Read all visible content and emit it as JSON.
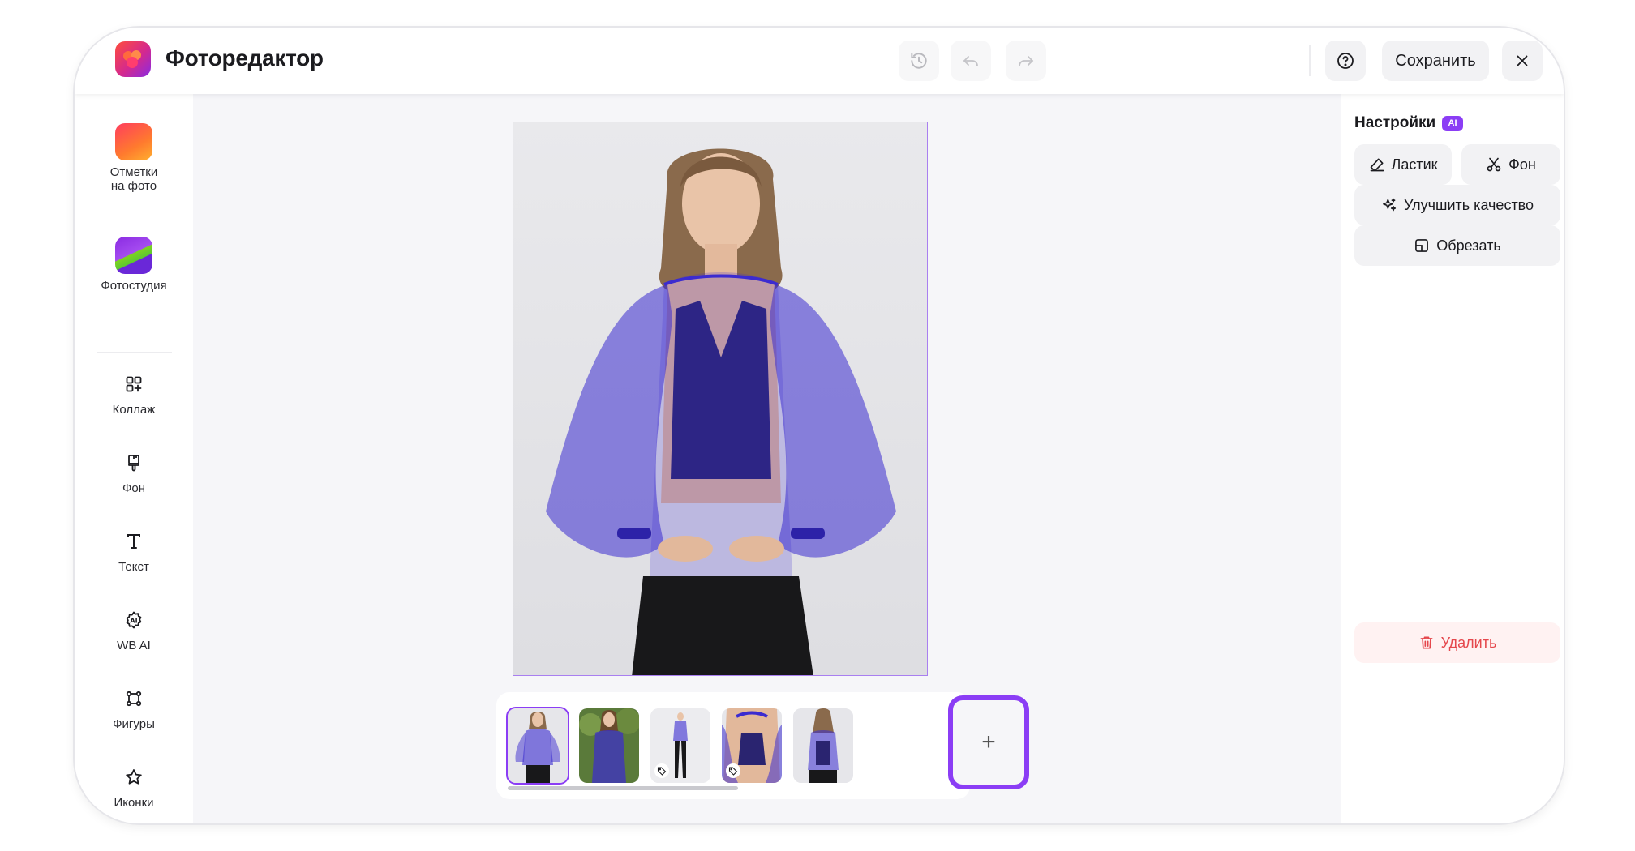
{
  "header": {
    "app_title": "Фоторедактор",
    "logo_icon": "app-logo-icon",
    "history_icon": "history-icon",
    "undo_icon": "undo-icon",
    "redo_icon": "redo-icon",
    "help_icon": "help-icon",
    "save_label": "Сохранить",
    "close_icon": "close-icon"
  },
  "sidebar": {
    "tools": [
      {
        "label_line1": "Отметки",
        "label_line2": "на фото",
        "icon": "photo-tags-icon"
      },
      {
        "label_line1": "Фотостудия",
        "label_line2": "",
        "icon": "photo-studio-icon"
      },
      {
        "label": "Коллаж",
        "icon": "collage-icon"
      },
      {
        "label": "Фон",
        "icon": "background-brush-icon"
      },
      {
        "label": "Текст",
        "icon": "text-icon"
      },
      {
        "label": "WB AI",
        "icon": "ai-icon"
      },
      {
        "label": "Фигуры",
        "icon": "shapes-icon"
      },
      {
        "label": "Иконки",
        "icon": "star-icon"
      }
    ]
  },
  "canvas": {
    "thumbnails": [
      {
        "selected": true,
        "has_tag": false
      },
      {
        "selected": false,
        "has_tag": false
      },
      {
        "selected": false,
        "has_tag": true
      },
      {
        "selected": false,
        "has_tag": true
      },
      {
        "selected": false,
        "has_tag": false
      }
    ],
    "add_label": "+"
  },
  "settings": {
    "title": "Настройки",
    "ai_badge": "AI",
    "eraser_label": "Ластик",
    "background_label": "Фон",
    "enhance_label": "Улучшить качество",
    "crop_label": "Обрезать",
    "delete_label": "Удалить"
  },
  "colors": {
    "accent": "#8b3df5",
    "danger": "#e5484d",
    "garment": "#3b2bd0"
  }
}
